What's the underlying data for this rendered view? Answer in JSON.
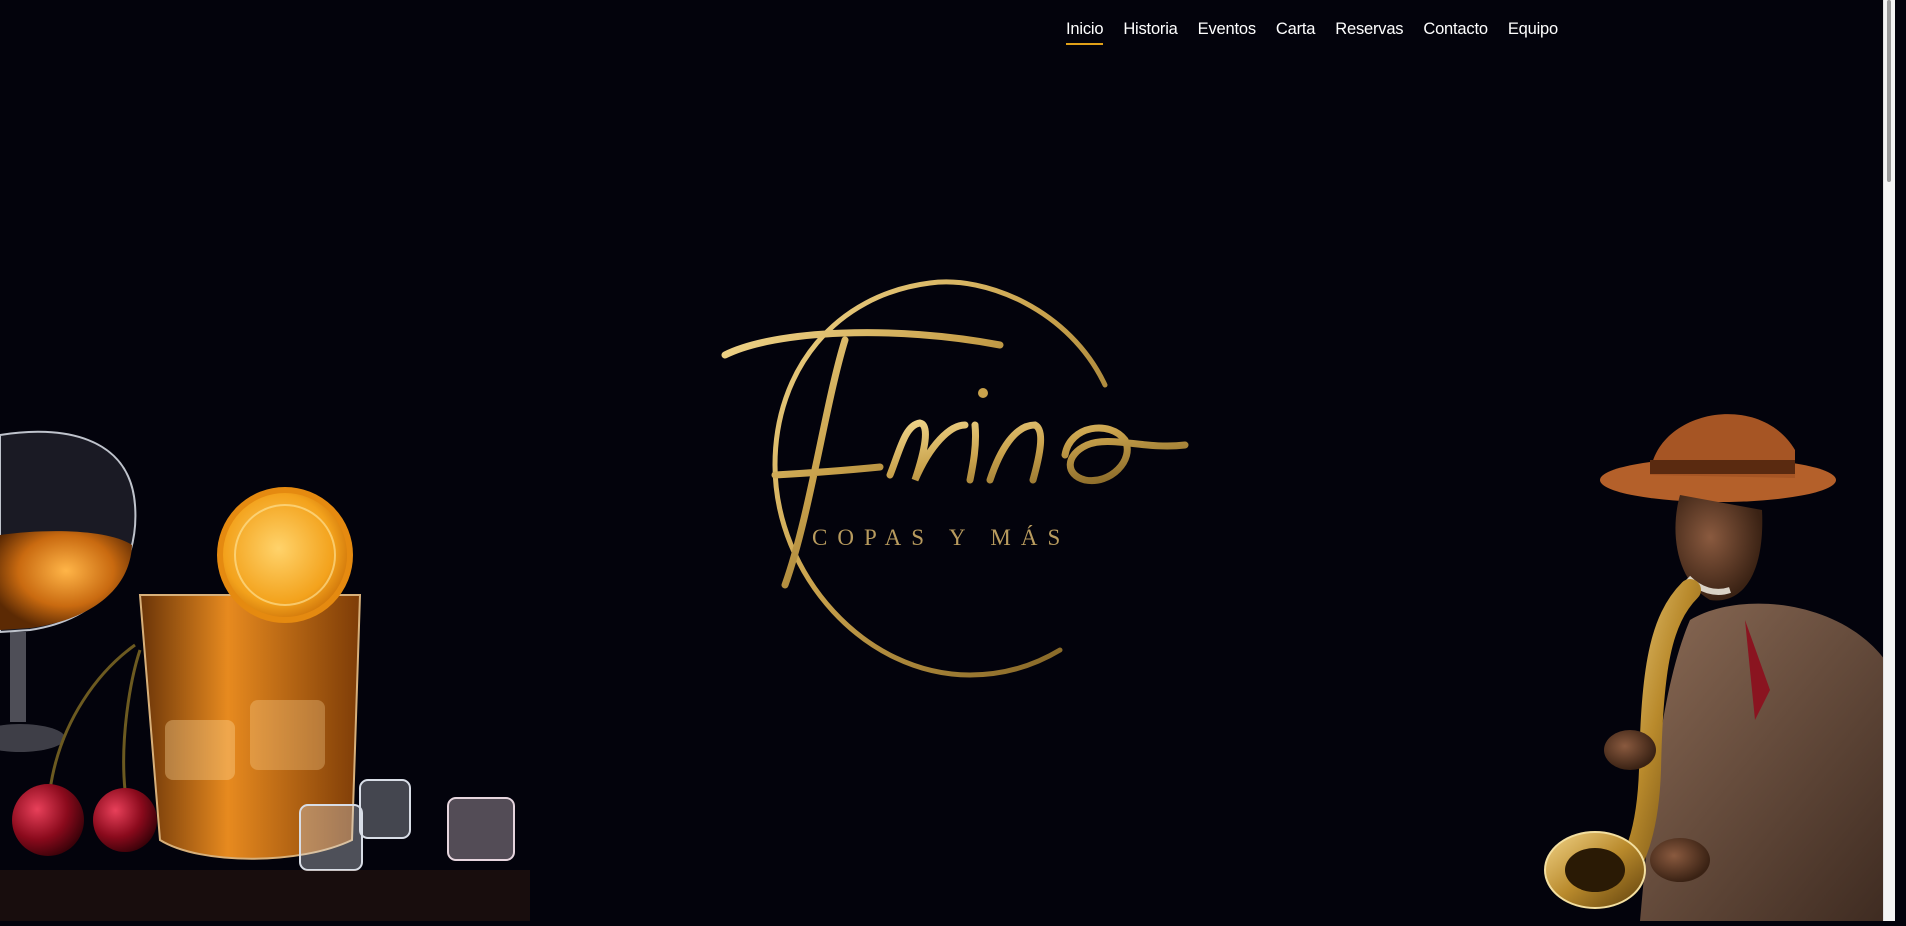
{
  "nav": {
    "items": [
      {
        "label": "Inicio",
        "active": true
      },
      {
        "label": "Historia",
        "active": false
      },
      {
        "label": "Eventos",
        "active": false
      },
      {
        "label": "Carta",
        "active": false
      },
      {
        "label": "Reservas",
        "active": false
      },
      {
        "label": "Contacto",
        "active": false
      },
      {
        "label": "Equipo",
        "active": false
      }
    ]
  },
  "logo": {
    "name": "Frino",
    "tagline": "COPAS Y MÁS"
  },
  "colors": {
    "background": "#03030c",
    "gold": "#c9a24c",
    "nav_underline": "#e0a018"
  }
}
